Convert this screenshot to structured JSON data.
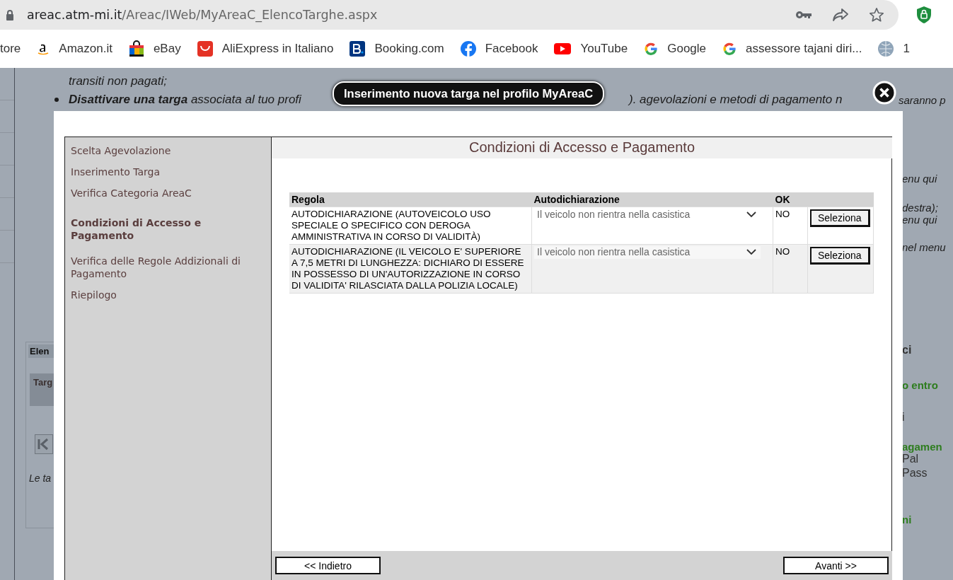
{
  "browser": {
    "url_host": "areac.atm-mi.it",
    "url_path": "/Areac/IWeb/MyAreaC_ElencoTarghe.aspx"
  },
  "bookmarks": [
    {
      "label": "tore",
      "kind": "none"
    },
    {
      "label": "Amazon.it",
      "kind": "amazon"
    },
    {
      "label": "eBay",
      "kind": "ebay"
    },
    {
      "label": "AliExpress in Italiano",
      "kind": "aliexpress"
    },
    {
      "label": "Booking.com",
      "kind": "booking"
    },
    {
      "label": "Facebook",
      "kind": "facebook"
    },
    {
      "label": "YouTube",
      "kind": "youtube"
    },
    {
      "label": "Google",
      "kind": "google"
    },
    {
      "label": "assessore tajani diri...",
      "kind": "google"
    },
    {
      "label": "1",
      "kind": "globe"
    }
  ],
  "background": {
    "bullet_tail": "transiti non pagati;",
    "bullet2_lead": "**Disattivare una targa** associata al tuo profi",
    "bullet2_mid": "). agevolazioni e metodi di pagamento n",
    "bullet2_end": "saranno p",
    "left_box": {
      "title": "Elen",
      "column": "Targ",
      "note": "Le ta"
    },
    "right_fragments": [
      {
        "text": "enu qui",
        "kind": "text"
      },
      {
        "text": "destra);",
        "kind": "text"
      },
      {
        "text": "enu qui",
        "kind": "text"
      },
      {
        "text": "nel menu",
        "kind": "text"
      },
      {
        "text": "ci",
        "kind": "title"
      },
      {
        "text": "o entro",
        "kind": "heading"
      },
      {
        "text": "i",
        "kind": "plain"
      },
      {
        "text": "agamen",
        "kind": "heading"
      },
      {
        "text": "Pal",
        "kind": "plain"
      },
      {
        "text": "Pass",
        "kind": "plain"
      },
      {
        "text": "ni",
        "kind": "heading"
      }
    ]
  },
  "dialog": {
    "title": "Inserimento nuova targa nel profilo MyAreaC",
    "steps": [
      {
        "label": "Scelta Agevolazione",
        "selected": false
      },
      {
        "label": "Inserimento Targa",
        "selected": false
      },
      {
        "label": "Verifica Categoria AreaC",
        "selected": false
      },
      {
        "label": "Condizioni di Accesso e Pagamento",
        "selected": true
      },
      {
        "label": "Verifica delle Regole Addizionali di Pagamento",
        "selected": false
      },
      {
        "label": "Riepilogo",
        "selected": false
      }
    ],
    "heading": "Condizioni di Accesso e Pagamento",
    "table": {
      "columns": [
        "Regola",
        "Autodichiarazione",
        "OK"
      ],
      "rows": [
        {
          "rule": "AUTODICHIARAZIONE (AUTOVEICOLO USO SPECIALE O SPECIFICO CON DEROGA AMMINISTRATIVA IN CORSO DI VALIDITÀ)",
          "declaration": "Il veicolo non rientra nella casistica",
          "ok": "NO",
          "button": "Seleziona"
        },
        {
          "rule": "AUTODICHIARAZIONE (IL VEICOLO E' SUPERIORE A 7,5 METRI DI LUNGHEZZA: DICHIARO DI ESSERE IN POSSESSO DI UN'AUTORIZZAZIONE IN CORSO DI VALIDITA' RILASCIATA DALLA POLIZIA LOCALE)",
          "declaration": "Il veicolo non rientra nella casistica",
          "ok": "NO",
          "button": "Seleziona"
        }
      ]
    },
    "back_button": "<< Indietro",
    "next_button": "Avanti >>"
  }
}
